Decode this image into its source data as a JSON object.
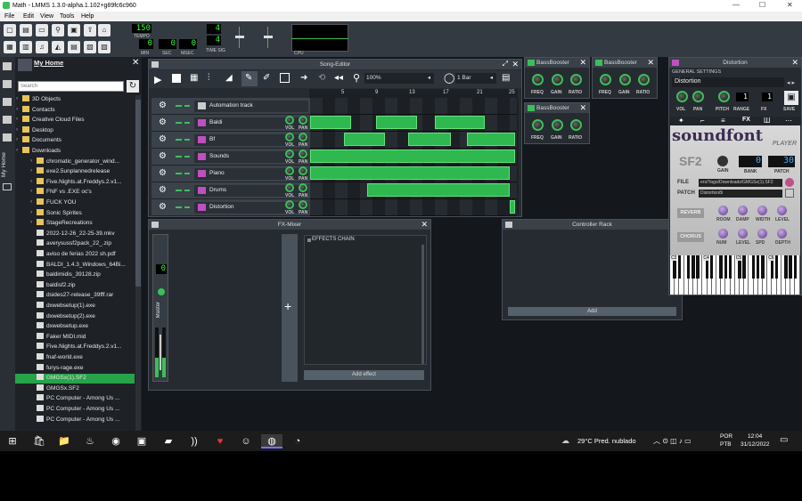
{
  "window": {
    "title": "Math - LMMS 1.3.0-alpha.1.102+g89fc6c960",
    "minimize": "—",
    "maximize": "☐",
    "close": "✕"
  },
  "menu": [
    "File",
    "Edit",
    "View",
    "Tools",
    "Help"
  ],
  "transport": {
    "tempo": "150",
    "tempo_label": "TEMPO",
    "min": "0",
    "min_label": "MIN",
    "sec": "0",
    "sec_label": "SEC",
    "msec": "0",
    "msec_label": "MSEC",
    "ts_num": "4",
    "ts_den": "4",
    "ts_label": "TIME SIG",
    "cpu_label": "CPU"
  },
  "sidebar": {
    "tab_label": "My Home",
    "title": "My Home",
    "search_placeholder": "Search",
    "items": [
      {
        "name": "3D Objects",
        "type": "folder"
      },
      {
        "name": "Contacts",
        "type": "folder"
      },
      {
        "name": "Creative Cloud Files",
        "type": "folder"
      },
      {
        "name": "Desktop",
        "type": "folder"
      },
      {
        "name": "Documents",
        "type": "folder"
      },
      {
        "name": "Downloads",
        "type": "folder"
      },
      {
        "name": "chromatic_generator_wind...",
        "type": "folder"
      },
      {
        "name": "exe2.5unplannedrelease",
        "type": "folder"
      },
      {
        "name": "Five.Nights.at.Freddys.2.v1...",
        "type": "folder"
      },
      {
        "name": "FNF vs .EXE oc's",
        "type": "folder"
      },
      {
        "name": "FUCK YOU",
        "type": "folder"
      },
      {
        "name": "Sonic Spirites",
        "type": "folder"
      },
      {
        "name": "StageRecreations",
        "type": "folder"
      },
      {
        "name": "2022-12-26_22-25-39.mkv",
        "type": "file"
      },
      {
        "name": "averysussf2pack_22_.zip",
        "type": "file"
      },
      {
        "name": "aviso de ferias 2022 sh.pdf",
        "type": "file"
      },
      {
        "name": "BALDI_1.4.3_Windows_64Bi...",
        "type": "file"
      },
      {
        "name": "baldimidis_39128.zip",
        "type": "file"
      },
      {
        "name": "baldisf2.zip",
        "type": "file"
      },
      {
        "name": "dsides27-release_39fff.rar",
        "type": "file"
      },
      {
        "name": "dxwebsetup(1).exe",
        "type": "file"
      },
      {
        "name": "dxwebsetup(2).exe",
        "type": "file"
      },
      {
        "name": "dxwebsetup.exe",
        "type": "file"
      },
      {
        "name": "Faker MIDI.mid",
        "type": "file"
      },
      {
        "name": "Five.Nights.at.Freddys.2.v1...",
        "type": "file"
      },
      {
        "name": "fnaf-world.exe",
        "type": "file"
      },
      {
        "name": "furys-rage.exe",
        "type": "file"
      },
      {
        "name": "GMGSx(1).SF2",
        "type": "file",
        "selected": true
      },
      {
        "name": "GMGSx.SF2",
        "type": "file"
      },
      {
        "name": "PC Computer - Among Us ...",
        "type": "file"
      },
      {
        "name": "PC Computer - Among Us ...",
        "type": "file"
      },
      {
        "name": "PC Computer - Among Us ...",
        "type": "file"
      }
    ]
  },
  "song_editor": {
    "title": "Song-Editor",
    "zoom": "100%",
    "quantize": "1 Bar",
    "bar_numbers": [
      "5",
      "9",
      "13",
      "17",
      "21",
      "25"
    ],
    "tracks": [
      {
        "name": "Automation track"
      },
      {
        "name": "Baldi"
      },
      {
        "name": "Bf"
      },
      {
        "name": "Sounds"
      },
      {
        "name": "Piano"
      },
      {
        "name": "Drums"
      },
      {
        "name": "Distortion"
      }
    ],
    "vol_label": "VOL",
    "pan_label": "PAN"
  },
  "fx_mixer": {
    "title": "FX-Mixer",
    "master": "Master",
    "channel_value": "0",
    "effects_chain": "EFFECTS CHAIN",
    "add_effect": "Add effect"
  },
  "controller_rack": {
    "title": "Controller Rack",
    "add": "Add"
  },
  "bassbooster": {
    "title": "BassBooster",
    "freq": "FREQ",
    "gain": "GAIN",
    "ratio": "RATIO"
  },
  "distortion": {
    "title": "Distortion",
    "general": "GENERAL SETTINGS",
    "name": "Distortion",
    "vol": "VOL",
    "pan": "PAN",
    "pitch": "PITCH",
    "range": "RANGE",
    "range_value": "1",
    "save": "SAVE",
    "fx": "FX"
  },
  "soundfont": {
    "logo": "soundfont",
    "logo2": "PLAYER",
    "sf2": "SF2",
    "gain": "GAIN",
    "bank": "0",
    "bank_label": "BANK",
    "patch": "30",
    "patch_label": "PATCH",
    "file_label": "FILE",
    "file_value": "ers/Yago/Downloads/GMGSx(1).SF2",
    "patch_row_label": "PATCH",
    "patch_value": "Distortion8i",
    "reverb": "REVERB",
    "chorus": "CHORUS",
    "r_labels": [
      "ROOM",
      "DAMP",
      "WIDTH",
      "LEVEL"
    ],
    "c_labels": [
      "NUM",
      "LEVEL",
      "SPD",
      "DEPTH"
    ],
    "keys": [
      "C3",
      "C4",
      "C5",
      "C6"
    ]
  },
  "taskbar": {
    "weather": "29°C Pred. nublado",
    "lang1": "POR",
    "lang2": "PTB",
    "time": "12:04",
    "date": "31/12/2022"
  }
}
